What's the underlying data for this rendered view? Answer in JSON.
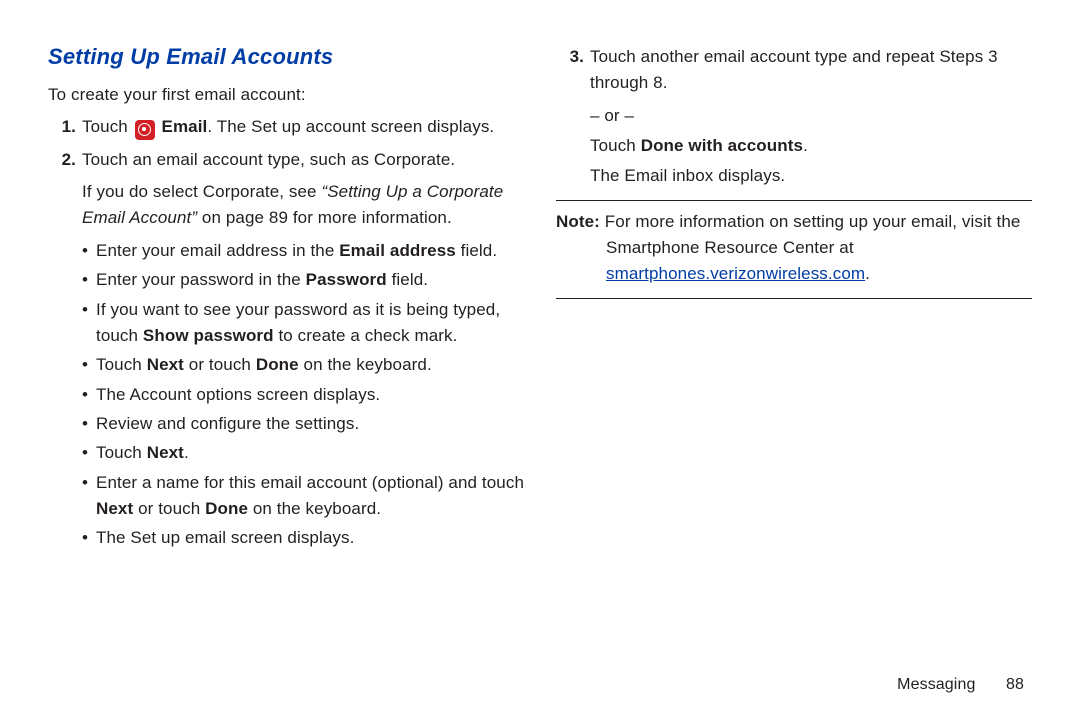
{
  "heading": "Setting Up Email Accounts",
  "intro": "To create your first email account:",
  "left": {
    "step1": {
      "num": "1.",
      "pre": "Touch ",
      "boldEmail": "Email",
      "post": ". The Set up account screen displays."
    },
    "step2": {
      "num": "2.",
      "text": "Touch an email account type, such as Corporate.",
      "corp_pre": "If you do select Corporate, see ",
      "corp_ital": "“Setting Up a Corporate Email Account”",
      "corp_post": " on page 89 for more information."
    },
    "bullets": {
      "b1a": "Enter your email address in the ",
      "b1b": "Email address",
      "b1c": " field.",
      "b2a": "Enter your password in the ",
      "b2b": "Password",
      "b2c": " field.",
      "b3a": "If you want to see your password as it is being typed, touch ",
      "b3b": "Show password",
      "b3c": " to create a check mark.",
      "b4a": "Touch ",
      "b4b": "Next",
      "b4c": " or touch ",
      "b4d": "Done",
      "b4e": " on the keyboard.",
      "b5": "The Account options screen displays.",
      "b6": "Review and configure the settings.",
      "b7a": "Touch ",
      "b7b": "Next",
      "b7c": ".",
      "b8a": "Enter a name for this email account (optional) and touch ",
      "b8b": "Next",
      "b8c": " or touch ",
      "b8d": "Done",
      "b8e": " on the keyboard.",
      "b9": "The Set up email screen displays."
    }
  },
  "right": {
    "step3": {
      "num": "3.",
      "line1": "Touch another email account type and repeat Steps 3 through 8.",
      "or": "– or –",
      "line2a": "Touch ",
      "line2b": "Done with accounts",
      "line2c": ".",
      "line3": "The Email inbox displays."
    },
    "note": {
      "label": "Note:",
      "text": " For more information on setting up your email, visit the Smartphone Resource Center at ",
      "link": "smartphones.verizonwireless.com",
      "tail": "."
    }
  },
  "footer": {
    "section": "Messaging",
    "page": "88"
  }
}
